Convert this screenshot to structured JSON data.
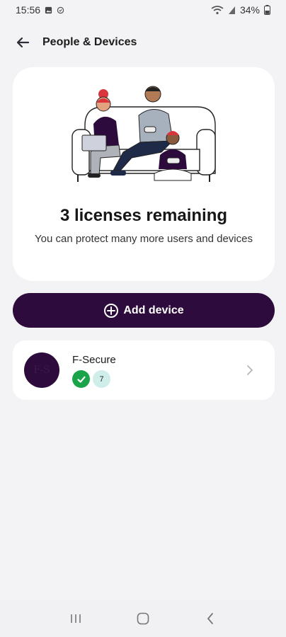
{
  "status_bar": {
    "time": "15:56",
    "battery": "34%",
    "icons": [
      "image-icon",
      "shield-check-icon",
      "wifi-icon",
      "signal-icon",
      "battery-icon"
    ]
  },
  "header": {
    "title": "People & Devices",
    "back_icon": "arrow-left-icon"
  },
  "hero": {
    "title": "3 licenses remaining",
    "subtitle": "You can protect many more users and devices",
    "illustration": "family-on-couch-illustration"
  },
  "add_device": {
    "label": "Add device",
    "icon": "plus-circle-icon"
  },
  "devices": [
    {
      "avatar_text": "F-S",
      "name": "F-Secure",
      "status_icon": "check-circle-icon",
      "count": "7"
    }
  ],
  "nav": {
    "items": [
      "recent-apps-icon",
      "home-icon",
      "back-icon"
    ]
  },
  "colors": {
    "background": "#f3f3f5",
    "brand_purple": "#2d0b3c",
    "success_green": "#1aa34a",
    "count_badge": "#cfeeea"
  }
}
